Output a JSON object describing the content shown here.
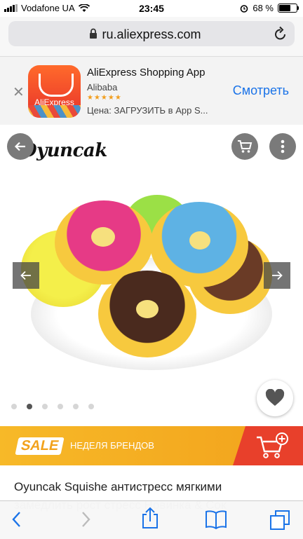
{
  "status": {
    "carrier": "Vodafone UA",
    "time": "23:45",
    "battery": "68 %",
    "battery_level": 0.68
  },
  "browser": {
    "url": "ru.aliexpress.com"
  },
  "app_banner": {
    "app_name": "AliExpress Shopping App",
    "publisher": "Alibaba",
    "stars": "★★★★★",
    "price": "Цена: ЗАГРУЗИТЬ в App S...",
    "view_label": "Смотреть",
    "icon_label": "AliExpress"
  },
  "product": {
    "brand": "Oyuncak",
    "title": "Oyuncak Squishe антистресс мягкими",
    "title_cont": "замедлить рост стресс Новинка & Сок",
    "image_count": 6,
    "active_image": 2
  },
  "sale_banner": {
    "badge": "SALE",
    "text": "НЕДЕЛЯ БРЕНДОВ"
  },
  "colors": {
    "accent": "#1a73e8",
    "sale_orange": "#f2a21c",
    "sale_red": "#e8402b"
  }
}
